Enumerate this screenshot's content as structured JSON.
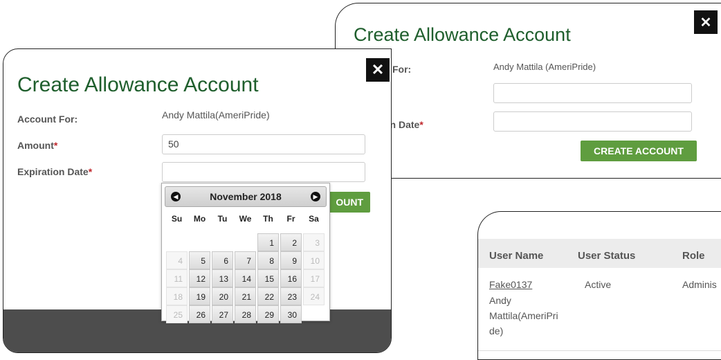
{
  "modal_front": {
    "title": "Create Allowance Account",
    "account_for_label": "Account For:",
    "account_for_value": "Andy Mattila(AmeriPride)",
    "amount_label": "Amount",
    "amount_value": "50",
    "expiration_label": "Expiration Date",
    "expiration_value": "",
    "required_mark": "*",
    "button_partial_label": "OUNT",
    "close_glyph": "✕"
  },
  "datepicker": {
    "month_label": "November 2018",
    "prev_glyph": "◀",
    "next_glyph": "▶",
    "weekdays": [
      "Su",
      "Mo",
      "Tu",
      "We",
      "Th",
      "Fr",
      "Sa"
    ],
    "weeks": [
      [
        "",
        "",
        "",
        "",
        "1",
        "2",
        "3"
      ],
      [
        "4",
        "5",
        "6",
        "7",
        "8",
        "9",
        "10"
      ],
      [
        "11",
        "12",
        "13",
        "14",
        "15",
        "16",
        "17"
      ],
      [
        "18",
        "19",
        "20",
        "21",
        "22",
        "23",
        "24"
      ],
      [
        "25",
        "26",
        "27",
        "28",
        "29",
        "30",
        ""
      ]
    ]
  },
  "modal_back": {
    "title": "Create Allowance Account",
    "account_for_label_partial": "For:",
    "account_for_value": "Andy Mattila (AmeriPride)",
    "expiration_label_partial": "on Date",
    "required_mark": "*",
    "create_button_label": "CREATE ACCOUNT",
    "close_glyph": "✕"
  },
  "user_table": {
    "headers": [
      "User Name",
      "User Status",
      "Role"
    ],
    "row": {
      "user_link": "Fake0137",
      "name_line1": "Andy",
      "name_line2": "Mattila(AmeriPri",
      "name_line3": "de)",
      "status": "Active",
      "role_partial": "Adminis"
    }
  }
}
